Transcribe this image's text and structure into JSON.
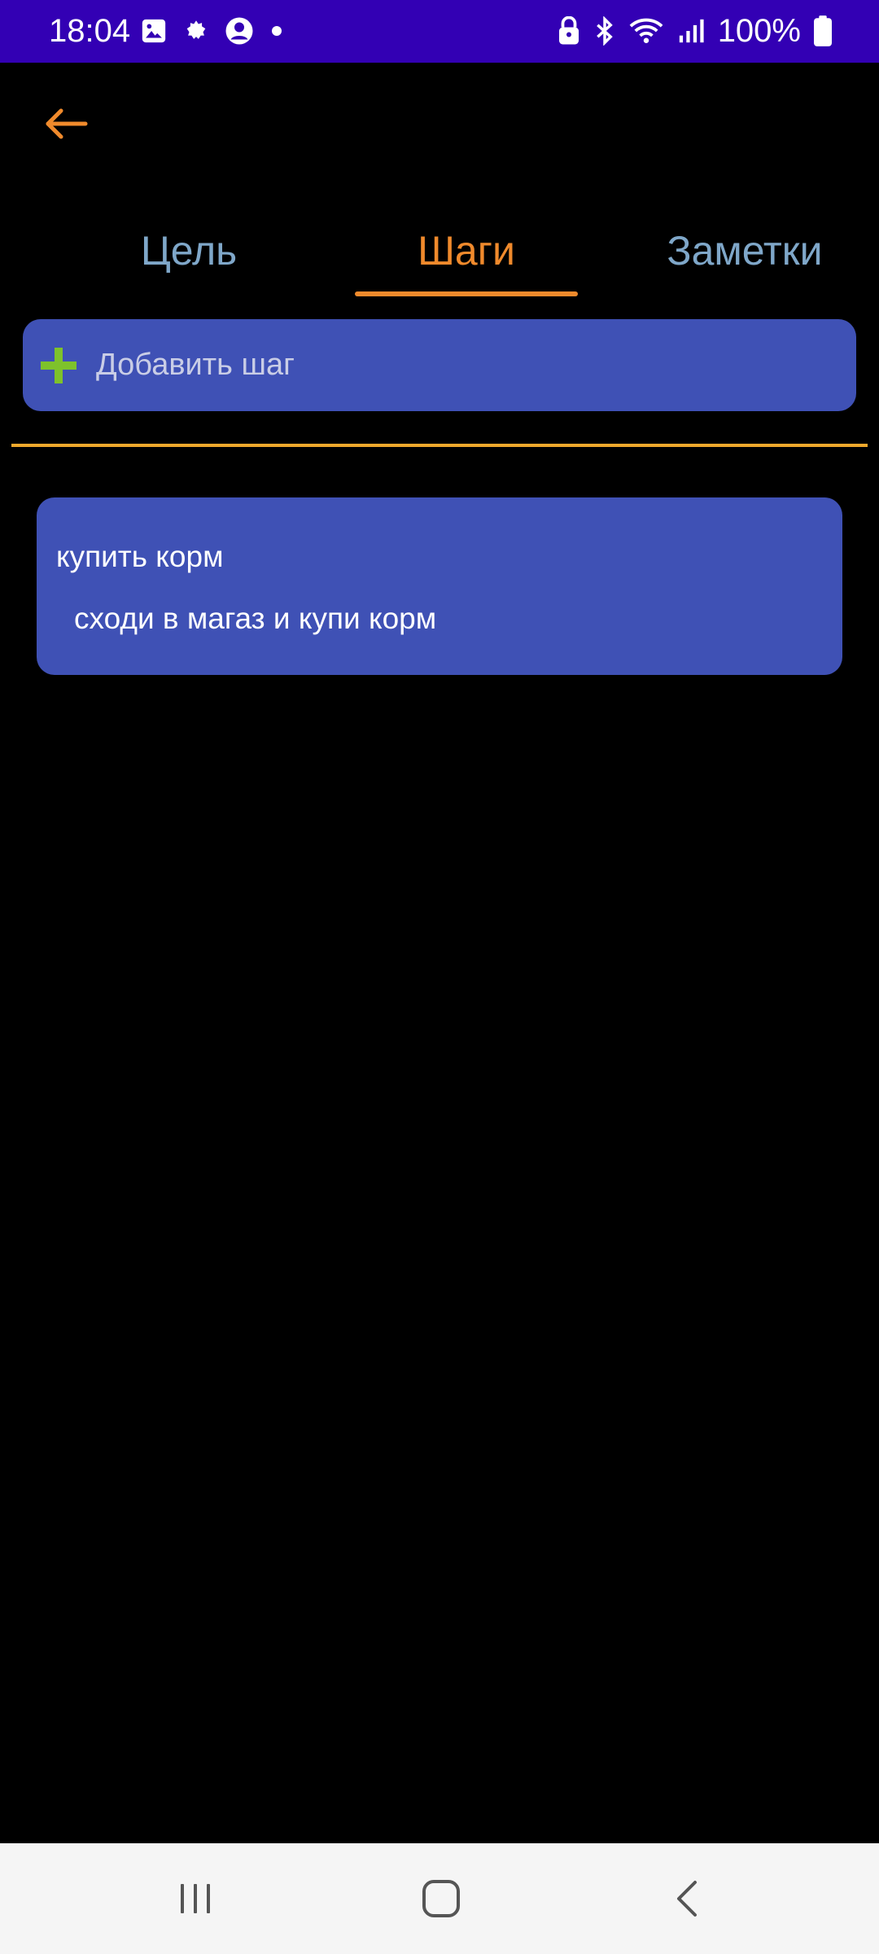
{
  "status_bar": {
    "time": "18:04",
    "battery": "100%",
    "background": "#3300b4",
    "left_icons": [
      "gallery-icon",
      "settings-flower-icon",
      "account-circle-icon",
      "dot-icon"
    ],
    "right_icons": [
      "lock-icon",
      "bluetooth-icon",
      "wifi-icon",
      "signal-icon",
      "battery-icon"
    ]
  },
  "header": {
    "back_icon": "arrow-left-icon",
    "accent_color": "#f08a2c"
  },
  "tabs": {
    "items": [
      {
        "label": "Цель",
        "selected": false
      },
      {
        "label": "Шаги",
        "selected": true
      },
      {
        "label": "Заметки",
        "selected": false
      }
    ],
    "active_color": "#f08a2c",
    "inactive_color": "#7fa7c9"
  },
  "add_step": {
    "label": "Добавить шаг",
    "icon": "plus-icon",
    "background": "#3f51b5"
  },
  "steps": [
    {
      "title": "купить корм",
      "description": "сходи в магаз и купи корм"
    }
  ],
  "nav_bar": {
    "buttons": [
      "recents-icon",
      "home-icon",
      "back-chevron-icon"
    ]
  }
}
